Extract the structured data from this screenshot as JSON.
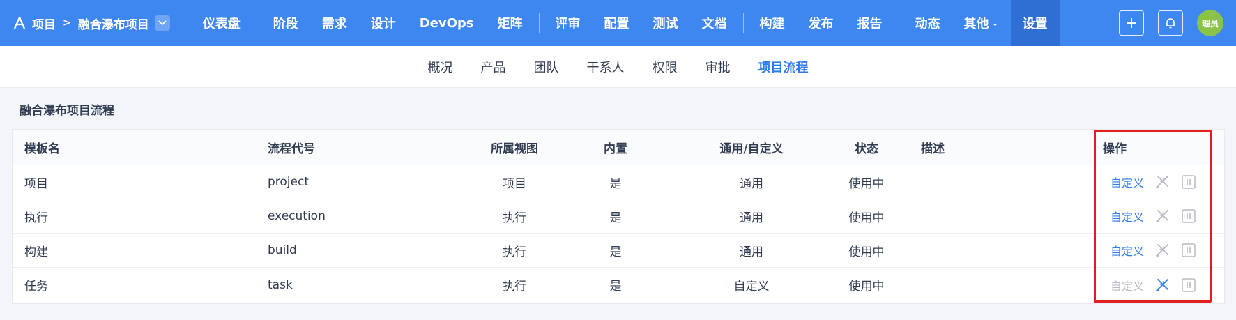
{
  "topbar": {
    "breadcrumb_root": "项目",
    "project_name": "融合瀑布项目",
    "nav": [
      "仪表盘",
      "阶段",
      "需求",
      "设计",
      "DevOps",
      "矩阵",
      "评审",
      "配置",
      "测试",
      "文档",
      "构建",
      "发布",
      "报告",
      "动态",
      "其他",
      "设置"
    ],
    "avatar_text": "理员"
  },
  "subnav": [
    "概况",
    "产品",
    "团队",
    "干系人",
    "权限",
    "审批",
    "项目流程"
  ],
  "section_title": "融合瀑布项目流程",
  "table": {
    "headers": [
      "模板名",
      "流程代号",
      "所属视图",
      "内置",
      "通用/自定义",
      "状态",
      "描述",
      "操作"
    ],
    "rows": [
      {
        "name": "项目",
        "code": "project",
        "view": "项目",
        "builtin": "是",
        "type": "通用",
        "status": "使用中",
        "desc": "",
        "action": "自定义"
      },
      {
        "name": "执行",
        "code": "execution",
        "view": "执行",
        "builtin": "是",
        "type": "通用",
        "status": "使用中",
        "desc": "",
        "action": "自定义"
      },
      {
        "name": "构建",
        "code": "build",
        "view": "执行",
        "builtin": "是",
        "type": "通用",
        "status": "使用中",
        "desc": "",
        "action": "自定义"
      },
      {
        "name": "任务",
        "code": "task",
        "view": "执行",
        "builtin": "是",
        "type": "自定义",
        "status": "使用中",
        "desc": "",
        "action": "自定义"
      }
    ]
  },
  "colors": {
    "primary": "#3f87f0",
    "active_nav": "#2f6fd3",
    "link": "#2e7bf0",
    "highlight": "#e02020"
  }
}
